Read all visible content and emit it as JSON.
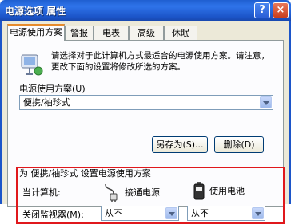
{
  "window": {
    "title": "电源选项 属性",
    "help_glyph": "?",
    "close_glyph": "×"
  },
  "tabs": [
    {
      "label": "电源使用方案",
      "active": true
    },
    {
      "label": "警报"
    },
    {
      "label": "电表"
    },
    {
      "label": "高级"
    },
    {
      "label": "休眠"
    }
  ],
  "intro": {
    "text": "请选择对于此计算机方式最适合的电源使用方案。请注意，更改下面的设置将修改所选的方案。"
  },
  "scheme": {
    "group_label": "电源使用方案(U)",
    "selected": "便携/袖珍式",
    "save_as_label": "另存为(S)...",
    "delete_label": "删除(D)"
  },
  "settings": {
    "group_label": "为 便携/袖珍式 设置电源使用方案",
    "when_computer_label": "当计算机:",
    "plugged_in_label": "接通电源",
    "on_battery_label": "使用电池",
    "monitor_off_label": "关闭监视器(M):",
    "monitor_plugged": "从不",
    "monitor_battery": "从不"
  },
  "colors": {
    "titlebar": "#2f74ea",
    "highlight": "#e0181c",
    "tab_accent": "#e68b2c"
  }
}
